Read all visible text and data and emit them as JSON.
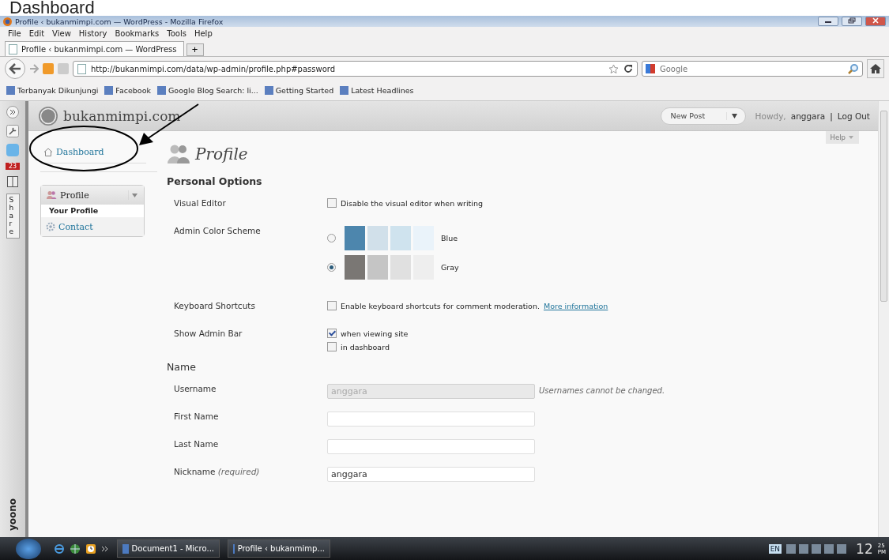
{
  "annotation": {
    "caption": "Dashboard"
  },
  "window": {
    "title": "Profile ‹ bukanmimpi.com — WordPress - Mozilla Firefox"
  },
  "menu": [
    "File",
    "Edit",
    "View",
    "History",
    "Bookmarks",
    "Tools",
    "Help"
  ],
  "tabs": [
    {
      "label": "Profile ‹ bukanmimpi.com — WordPress",
      "selected": true
    }
  ],
  "new_tab": "+",
  "address": {
    "value": "http://bukanmimpi.com/data/wp-admin/profile.php#password"
  },
  "search": {
    "placeholder": "Google"
  },
  "bookmarks": [
    "Terbanyak Dikunjungi",
    "Facebook",
    "Google Blog Search: li...",
    "Getting Started",
    "Latest Headlines"
  ],
  "side_toolbar": {
    "badge": "23",
    "share": "Share",
    "brand": "yoono"
  },
  "wp_header": {
    "site": "bukanmimpi.com",
    "favorite": "New Post",
    "howdy": "Howdy,",
    "user": "anggara",
    "separator": "|",
    "logout": "Log Out"
  },
  "help": "Help",
  "admin_menu": {
    "dashboard": "Dashboard",
    "group": "Profile",
    "submenu": [
      {
        "label": "Your Profile",
        "selected": true
      }
    ],
    "contact": "Contact"
  },
  "page_title": "Profile",
  "personal_options": {
    "heading": "Personal Options",
    "visual_editor": {
      "label": "Visual Editor",
      "option": "Disable the visual editor when writing",
      "checked": false
    },
    "color_scheme": {
      "label": "Admin Color Scheme",
      "schemes": [
        {
          "name": "Blue",
          "selected": false,
          "swatches": [
            {
              "color": "#4d86ad"
            },
            {
              "color": "#d1e0ea"
            },
            {
              "color": "#cfe3ee"
            },
            {
              "color": "#eaf3fa"
            }
          ]
        },
        {
          "name": "Gray",
          "selected": true,
          "swatches": [
            {
              "color": "#7a7774"
            },
            {
              "color": "#c5c5c5"
            },
            {
              "color": "#e0e0e0"
            },
            {
              "color": "#eeeeee"
            }
          ]
        }
      ]
    },
    "keyboard": {
      "label": "Keyboard Shortcuts",
      "option": "Enable keyboard shortcuts for comment moderation.",
      "link": "More information",
      "checked": false
    },
    "admin_bar": {
      "label": "Show Admin Bar",
      "options": [
        {
          "label": "when viewing site",
          "checked": true
        },
        {
          "label": "in dashboard",
          "checked": false
        }
      ]
    }
  },
  "name_section": {
    "heading": "Name",
    "fields": [
      {
        "label": "Username",
        "value": "anggara",
        "disabled": true,
        "note": "Usernames cannot be changed."
      },
      {
        "label": "First Name",
        "disabled": false
      },
      {
        "label": "Last Name",
        "disabled": false
      },
      {
        "label": "Nickname",
        "hint": "(required)",
        "value": "anggara",
        "disabled": false
      }
    ]
  },
  "taskbar": {
    "items": [
      "Document1 - Micro...",
      "Profile ‹ bukanmimp..."
    ],
    "lang": "EN",
    "clock": "12",
    "clock_minutes": "25",
    "clock_ampm": "PM"
  }
}
